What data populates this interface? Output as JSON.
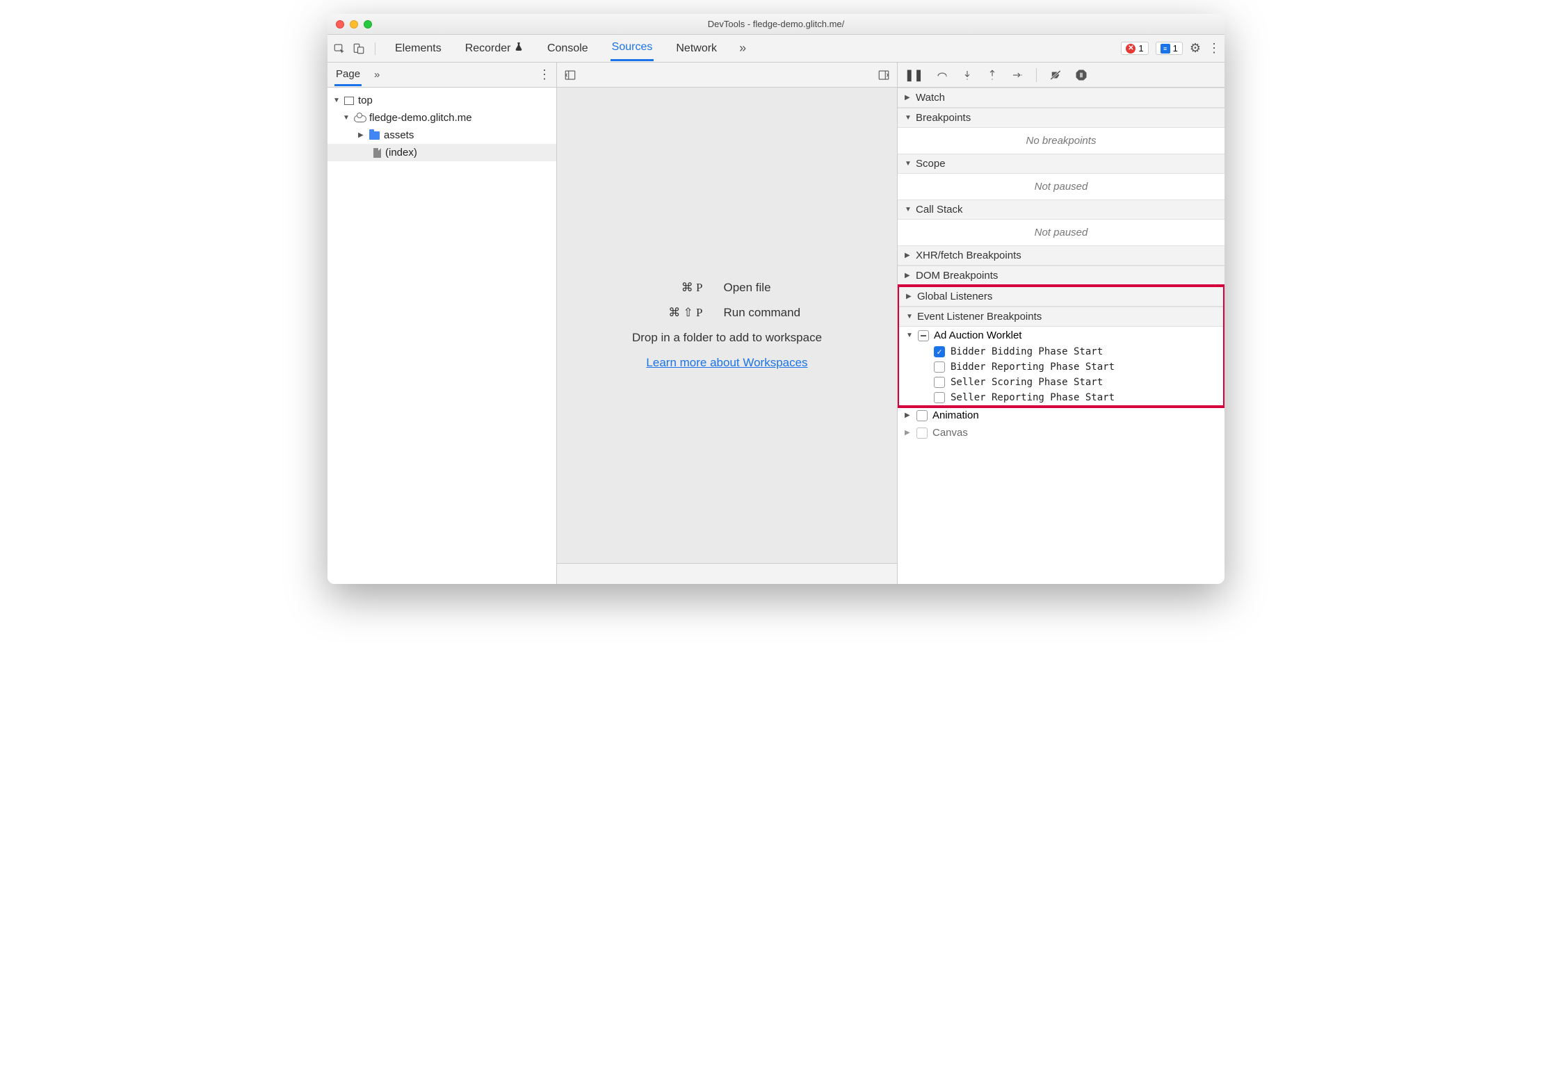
{
  "window_title": "DevTools - fledge-demo.glitch.me/",
  "toolbar": {
    "tabs": [
      "Elements",
      "Recorder",
      "Console",
      "Sources",
      "Network"
    ],
    "active_tab": "Sources",
    "errors_count": "1",
    "messages_count": "1"
  },
  "nav": {
    "page_label": "Page",
    "tree": {
      "top": "top",
      "origin": "fledge-demo.glitch.me",
      "folder": "assets",
      "file": "(index)"
    }
  },
  "editor": {
    "open_file_keys": "⌘ P",
    "open_file_label": "Open file",
    "run_cmd_keys": "⌘ ⇧ P",
    "run_cmd_label": "Run command",
    "drop_text": "Drop in a folder to add to workspace",
    "learn_link": "Learn more about Workspaces"
  },
  "debugger": {
    "watch_label": "Watch",
    "breakpoints_label": "Breakpoints",
    "no_breakpoints": "No breakpoints",
    "scope_label": "Scope",
    "not_paused1": "Not paused",
    "callstack_label": "Call Stack",
    "not_paused2": "Not paused",
    "xhr_label": "XHR/fetch Breakpoints",
    "dom_label": "DOM Breakpoints",
    "global_label": "Global Listeners",
    "elb_label": "Event Listener Breakpoints",
    "group_label": "Ad Auction Worklet",
    "evt1": "Bidder Bidding Phase Start",
    "evt2": "Bidder Reporting Phase Start",
    "evt3": "Seller Scoring Phase Start",
    "evt4": "Seller Reporting Phase Start",
    "animation_label": "Animation",
    "canvas_label": "Canvas"
  }
}
